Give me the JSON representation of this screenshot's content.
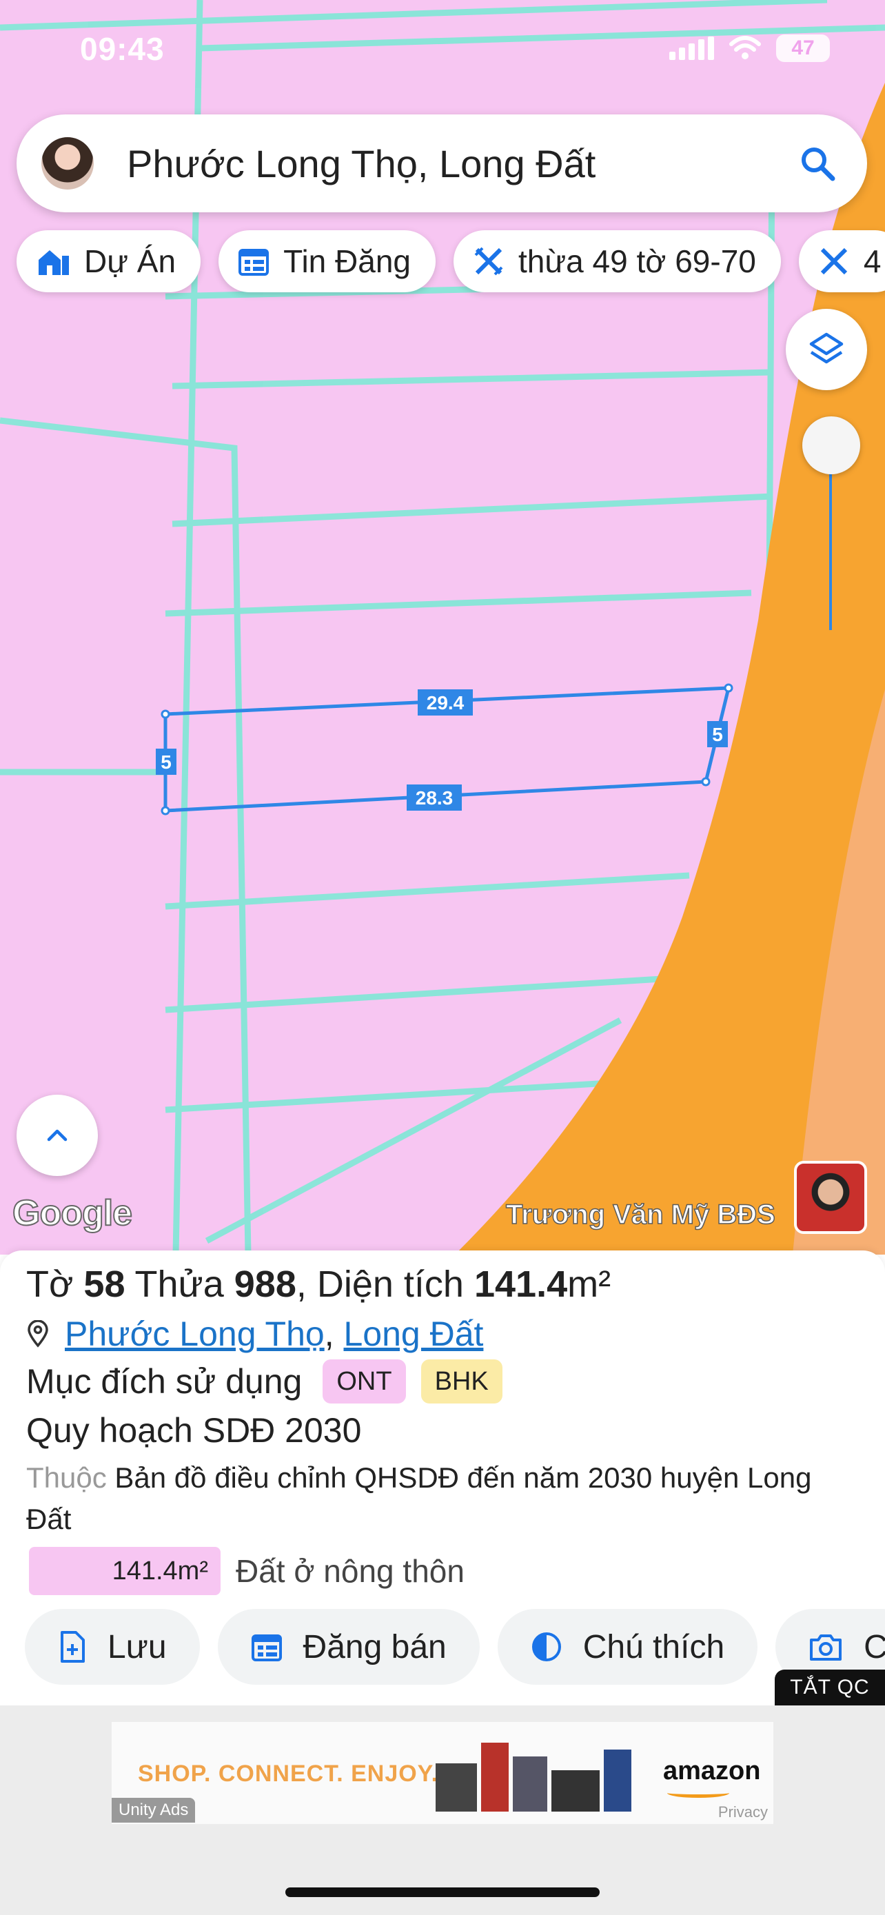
{
  "status": {
    "time": "09:43",
    "battery": "47"
  },
  "search": {
    "text": "Phước Long Thọ, Long Đất"
  },
  "chips": [
    {
      "label": "Dự Án",
      "icon": "home-icon"
    },
    {
      "label": "Tin Đăng",
      "icon": "calendar-icon"
    },
    {
      "label": "thừa 49 tờ 69-70",
      "icon": "ruler-icon"
    },
    {
      "label": "4",
      "icon": "ruler-icon"
    }
  ],
  "map": {
    "colors": {
      "land": "#f7c6f2",
      "road": "#f7a430",
      "boundary": "#7fe8d6",
      "selection": "#2f87e6"
    },
    "dimensions": {
      "top": "29.4",
      "bottom": "28.3",
      "left": "5",
      "right": "5"
    },
    "google_logo": "Google",
    "owner_name": "Trương Văn Mỹ BĐS"
  },
  "parcel": {
    "to_label": "Tờ",
    "to_number": "58",
    "thua_label": "Thửa",
    "thua_number": "988",
    "area_label": ", Diện tích",
    "area_value": "141.4",
    "area_unit": "m²",
    "ward": "Phước Long Thọ",
    "district": "Long Đất",
    "purpose_label": "Mục đích sử dụng",
    "purpose_tags": [
      "ONT",
      "BHK"
    ],
    "plan_title": "Quy hoạch SDĐ 2030",
    "belongs_prefix": "Thuộc",
    "belongs_text": "Bản đồ điều chỉnh QHSDĐ đến năm 2030 huyện Long Đất",
    "area_box": "141.4m²",
    "area_desc": "Đất ở nông thôn"
  },
  "actions": [
    {
      "label": "Lưu",
      "icon": "file-plus-icon"
    },
    {
      "label": "Đăng bán",
      "icon": "calendar-icon"
    },
    {
      "label": "Chú thích",
      "icon": "contrast-icon"
    },
    {
      "label": "C",
      "icon": "camera-plus-icon"
    }
  ],
  "ad": {
    "close_label": "TẮT QC",
    "slogan": "SHOP. CONNECT. ENJOY.",
    "brand": "amazon",
    "network": "Unity Ads",
    "privacy": "Privacy"
  }
}
